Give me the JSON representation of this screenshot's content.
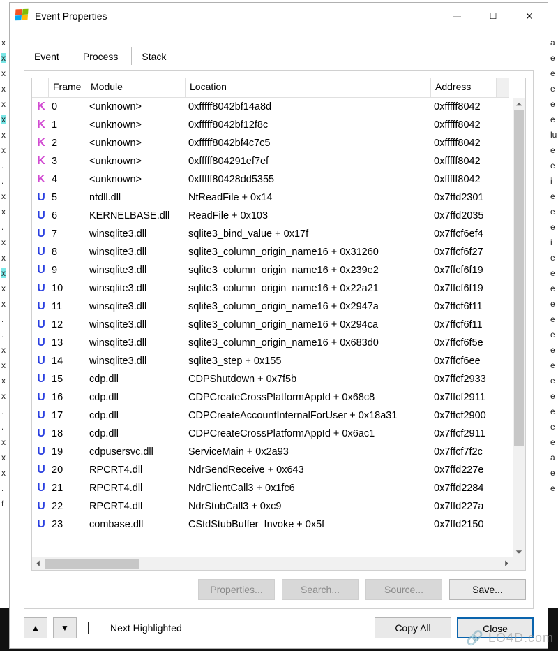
{
  "window": {
    "title": "Event Properties"
  },
  "tabs": [
    {
      "label": "Event",
      "active": false
    },
    {
      "label": "Process",
      "active": false
    },
    {
      "label": "Stack",
      "active": true
    }
  ],
  "columns": {
    "frame": "Frame",
    "module": "Module",
    "location": "Location",
    "address": "Address"
  },
  "rows": [
    {
      "mode": "K",
      "frame": "0",
      "module": "<unknown>",
      "location": "0xfffff8042bf14a8d",
      "address": "0xfffff8042"
    },
    {
      "mode": "K",
      "frame": "1",
      "module": "<unknown>",
      "location": "0xfffff8042bf12f8c",
      "address": "0xfffff8042"
    },
    {
      "mode": "K",
      "frame": "2",
      "module": "<unknown>",
      "location": "0xfffff8042bf4c7c5",
      "address": "0xfffff8042"
    },
    {
      "mode": "K",
      "frame": "3",
      "module": "<unknown>",
      "location": "0xfffff804291ef7ef",
      "address": "0xfffff8042"
    },
    {
      "mode": "K",
      "frame": "4",
      "module": "<unknown>",
      "location": "0xfffff80428dd5355",
      "address": "0xfffff8042"
    },
    {
      "mode": "U",
      "frame": "5",
      "module": "ntdll.dll",
      "location": "NtReadFile + 0x14",
      "address": "0x7ffd2301"
    },
    {
      "mode": "U",
      "frame": "6",
      "module": "KERNELBASE.dll",
      "location": "ReadFile + 0x103",
      "address": "0x7ffd2035"
    },
    {
      "mode": "U",
      "frame": "7",
      "module": "winsqlite3.dll",
      "location": "sqlite3_bind_value + 0x17f",
      "address": "0x7ffcf6ef4"
    },
    {
      "mode": "U",
      "frame": "8",
      "module": "winsqlite3.dll",
      "location": "sqlite3_column_origin_name16 + 0x31260",
      "address": "0x7ffcf6f27"
    },
    {
      "mode": "U",
      "frame": "9",
      "module": "winsqlite3.dll",
      "location": "sqlite3_column_origin_name16 + 0x239e2",
      "address": "0x7ffcf6f19"
    },
    {
      "mode": "U",
      "frame": "10",
      "module": "winsqlite3.dll",
      "location": "sqlite3_column_origin_name16 + 0x22a21",
      "address": "0x7ffcf6f19"
    },
    {
      "mode": "U",
      "frame": "11",
      "module": "winsqlite3.dll",
      "location": "sqlite3_column_origin_name16 + 0x2947a",
      "address": "0x7ffcf6f11"
    },
    {
      "mode": "U",
      "frame": "12",
      "module": "winsqlite3.dll",
      "location": "sqlite3_column_origin_name16 + 0x294ca",
      "address": "0x7ffcf6f11"
    },
    {
      "mode": "U",
      "frame": "13",
      "module": "winsqlite3.dll",
      "location": "sqlite3_column_origin_name16 + 0x683d0",
      "address": "0x7ffcf6f5e"
    },
    {
      "mode": "U",
      "frame": "14",
      "module": "winsqlite3.dll",
      "location": "sqlite3_step + 0x155",
      "address": "0x7ffcf6ee"
    },
    {
      "mode": "U",
      "frame": "15",
      "module": "cdp.dll",
      "location": "CDPShutdown + 0x7f5b",
      "address": "0x7ffcf2933"
    },
    {
      "mode": "U",
      "frame": "16",
      "module": "cdp.dll",
      "location": "CDPCreateCrossPlatformAppId + 0x68c8",
      "address": "0x7ffcf2911"
    },
    {
      "mode": "U",
      "frame": "17",
      "module": "cdp.dll",
      "location": "CDPCreateAccountInternalForUser + 0x18a31",
      "address": "0x7ffcf2900"
    },
    {
      "mode": "U",
      "frame": "18",
      "module": "cdp.dll",
      "location": "CDPCreateCrossPlatformAppId + 0x6ac1",
      "address": "0x7ffcf2911"
    },
    {
      "mode": "U",
      "frame": "19",
      "module": "cdpusersvc.dll",
      "location": "ServiceMain + 0x2a93",
      "address": "0x7ffcf7f2c"
    },
    {
      "mode": "U",
      "frame": "20",
      "module": "RPCRT4.dll",
      "location": "NdrSendReceive + 0x643",
      "address": "0x7ffd227e"
    },
    {
      "mode": "U",
      "frame": "21",
      "module": "RPCRT4.dll",
      "location": "NdrClientCall3 + 0x1fc6",
      "address": "0x7ffd2284"
    },
    {
      "mode": "U",
      "frame": "22",
      "module": "RPCRT4.dll",
      "location": "NdrStubCall3 + 0xc9",
      "address": "0x7ffd227a"
    },
    {
      "mode": "U",
      "frame": "23",
      "module": "combase.dll",
      "location": "CStdStubBuffer_Invoke + 0x5f",
      "address": "0x7ffd2150"
    }
  ],
  "panel_buttons": {
    "properties": "Properties...",
    "search": "Search...",
    "source": "Source...",
    "save_prefix": "S",
    "save_ul": "a",
    "save_suffix": "ve..."
  },
  "bottom": {
    "next_highlighted": "Next Highlighted",
    "copy_all": "Copy All",
    "close": "Close"
  },
  "watermark": {
    "text": "LO4D.com"
  }
}
